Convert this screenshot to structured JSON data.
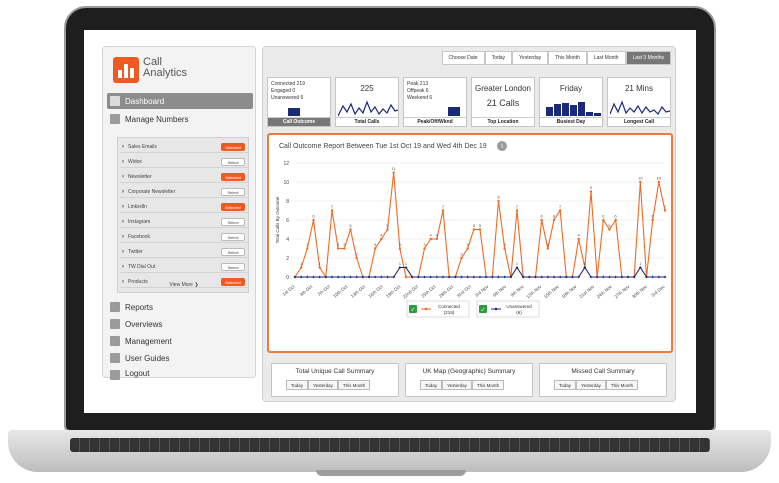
{
  "brand": {
    "line1": "Call",
    "line2": "Analytics"
  },
  "nav": {
    "dashboard": "Dashboard",
    "manage_numbers": "Manage Numbers",
    "reports": "Reports",
    "overviews": "Overviews",
    "management": "Management",
    "user_guides": "User Guides",
    "logout": "Logout"
  },
  "numbers": [
    {
      "label": "Sales Emails",
      "btn": "Selected",
      "selected": true
    },
    {
      "label": "Widox",
      "btn": "Select",
      "selected": false
    },
    {
      "label": "Newsletter",
      "btn": "Selected",
      "selected": true
    },
    {
      "label": "Corporate Newsletter",
      "btn": "Select",
      "selected": false
    },
    {
      "label": "LinkedIn",
      "btn": "Selected",
      "selected": true
    },
    {
      "label": "Instagram",
      "btn": "Select",
      "selected": false
    },
    {
      "label": "Facebook",
      "btn": "Select",
      "selected": false
    },
    {
      "label": "Twitter",
      "btn": "Select",
      "selected": false
    },
    {
      "label": "TW Dial Out",
      "btn": "Select",
      "selected": false
    },
    {
      "label": "Products",
      "btn": "Selected",
      "selected": true
    }
  ],
  "view_more": "View More ❯",
  "date_filters": [
    "Choose Date",
    "Today",
    "Yesterday",
    "This Month",
    "Last Month",
    "Last 3 Months"
  ],
  "active_filter": "Last 3 Months",
  "cards": {
    "outcome": {
      "connected": "Connected 219",
      "engaged": "Engaged 0",
      "unanswered": "Unanswered 6",
      "label": "Call Outcome"
    },
    "total": {
      "value": "225",
      "label": "Total Calls"
    },
    "peak": {
      "peak": "Peak 213",
      "offpeak": "Offpeak 6",
      "weekend": "Weekend 6",
      "label": "Peak/Off/Wknd"
    },
    "location": {
      "city": "Greater London",
      "calls": "21 Calls",
      "label": "Top Location"
    },
    "busiest": {
      "day": "Friday",
      "label": "Busiest Day"
    },
    "longest": {
      "value": "21 Mins",
      "label": "Longest Call"
    }
  },
  "chart_title": "Call Outcome Report Between Tue 1st Oct 19 and Wed 4th Dec 19",
  "chart_data": {
    "type": "line",
    "ylabel": "Total Calls By Outcome",
    "ylim": [
      0,
      12
    ],
    "yticks": [
      0,
      2,
      4,
      6,
      8,
      10,
      12
    ],
    "xticks": [
      "1st Oct",
      "4th Oct",
      "7th Oct",
      "10th Oct",
      "13th Oct",
      "16th Oct",
      "19th Oct",
      "22nd Oct",
      "25th Oct",
      "28th Oct",
      "31st Oct",
      "3rd Nov",
      "6th Nov",
      "9th Nov",
      "12th Nov",
      "15th Nov",
      "18th Nov",
      "21st Nov",
      "24th Nov",
      "27th Nov",
      "30th Nov",
      "3rd Dec"
    ],
    "series": [
      {
        "name": "Connected",
        "count": "(219)",
        "color": "#ef6a22",
        "values": [
          0,
          1,
          3,
          6,
          1,
          0,
          7,
          3,
          3,
          5,
          2,
          0,
          0,
          3,
          4,
          5,
          11,
          3,
          0,
          0,
          0,
          3,
          4,
          4,
          7,
          0,
          0,
          2,
          3,
          5,
          5,
          0,
          0,
          8,
          3,
          0,
          7,
          0,
          0,
          0,
          6,
          3,
          6,
          7,
          0,
          0,
          4,
          1,
          9,
          0,
          6,
          5,
          6,
          0,
          0,
          0,
          10,
          0,
          6,
          10,
          7
        ]
      },
      {
        "name": "Unanswered",
        "count": "(6)",
        "color": "#1b2a78",
        "values": [
          0,
          0,
          0,
          0,
          0,
          0,
          0,
          0,
          0,
          0,
          0,
          0,
          0,
          0,
          0,
          0,
          0,
          1,
          1,
          0,
          0,
          0,
          0,
          0,
          0,
          0,
          0,
          0,
          0,
          0,
          0,
          0,
          0,
          0,
          0,
          0,
          1,
          0,
          0,
          0,
          0,
          0,
          0,
          0,
          0,
          0,
          0,
          1,
          0,
          0,
          0,
          0,
          0,
          0,
          0,
          0,
          1,
          0,
          0,
          0,
          0
        ]
      }
    ]
  },
  "summaries": [
    {
      "title": "Total Unique Call Summary",
      "tabs": [
        "Today",
        "Yesterday",
        "This Month"
      ]
    },
    {
      "title": "UK Map (Geographic) Summary",
      "tabs": [
        "Today",
        "Yesterday",
        "This Month"
      ]
    },
    {
      "title": "Missed Call Summary",
      "tabs": [
        "Today",
        "Yesterday",
        "This Month"
      ]
    }
  ]
}
